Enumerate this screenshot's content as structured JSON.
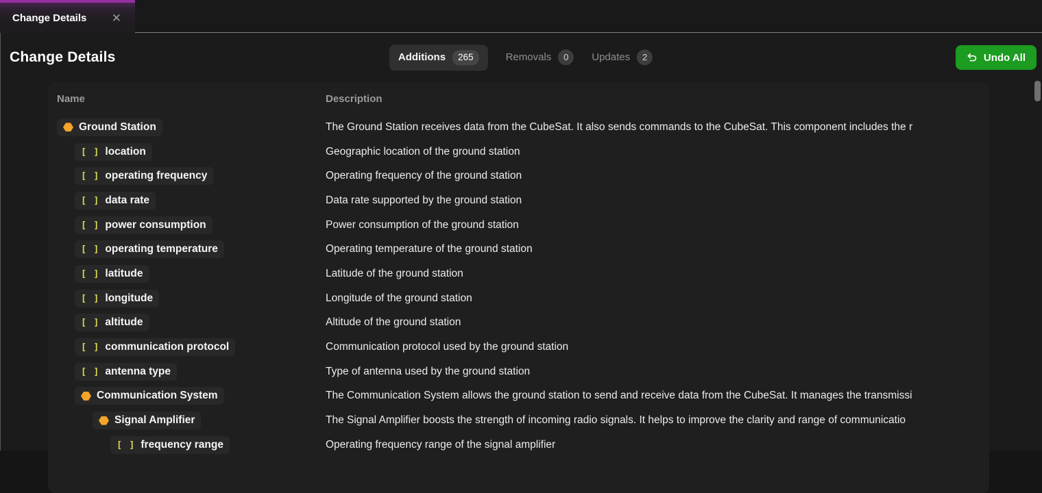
{
  "colors": {
    "accent_purple": "#9130a1",
    "accent_green": "#1c9c20",
    "component_icon": "#f5a42a",
    "array_icon": "#d8d856"
  },
  "doc_tab": {
    "label": "Change Details",
    "close_glyph": "✕"
  },
  "header": {
    "title": "Change Details",
    "filter_tabs": [
      {
        "label": "Additions",
        "count": "265",
        "active": true
      },
      {
        "label": "Removals",
        "count": "0",
        "active": false
      },
      {
        "label": "Updates",
        "count": "2",
        "active": false
      }
    ],
    "undo_all_label": "Undo All"
  },
  "table": {
    "columns": {
      "name": "Name",
      "description": "Description"
    },
    "icons": {
      "component": "hexagon",
      "array_glyph": "[ ]"
    },
    "rows": [
      {
        "label": "Ground Station",
        "level": 0,
        "icon": "component",
        "description": "The Ground Station receives data from the CubeSat. It also sends commands to the CubeSat. This component includes the r"
      },
      {
        "label": "location",
        "level": 1,
        "icon": "array",
        "description": "Geographic location of the ground station"
      },
      {
        "label": "operating frequency",
        "level": 1,
        "icon": "array",
        "description": "Operating frequency of the ground station"
      },
      {
        "label": "data rate",
        "level": 1,
        "icon": "array",
        "description": "Data rate supported by the ground station"
      },
      {
        "label": "power consumption",
        "level": 1,
        "icon": "array",
        "description": "Power consumption of the ground station"
      },
      {
        "label": "operating temperature",
        "level": 1,
        "icon": "array",
        "description": "Operating temperature of the ground station"
      },
      {
        "label": "latitude",
        "level": 1,
        "icon": "array",
        "description": "Latitude of the ground station"
      },
      {
        "label": "longitude",
        "level": 1,
        "icon": "array",
        "description": "Longitude of the ground station"
      },
      {
        "label": "altitude",
        "level": 1,
        "icon": "array",
        "description": "Altitude of the ground station"
      },
      {
        "label": "communication protocol",
        "level": 1,
        "icon": "array",
        "description": "Communication protocol used by the ground station"
      },
      {
        "label": "antenna type",
        "level": 1,
        "icon": "array",
        "description": "Type of antenna used by the ground station"
      },
      {
        "label": "Communication System",
        "level": 1,
        "icon": "component",
        "description": "The Communication System allows the ground station to send and receive data from the CubeSat. It manages the transmissi"
      },
      {
        "label": "Signal Amplifier",
        "level": 2,
        "icon": "component",
        "description": "The Signal Amplifier boosts the strength of incoming radio signals. It helps to improve the clarity and range of communicatio"
      },
      {
        "label": "frequency range",
        "level": 3,
        "icon": "array",
        "description": "Operating frequency range of the signal amplifier"
      }
    ]
  }
}
